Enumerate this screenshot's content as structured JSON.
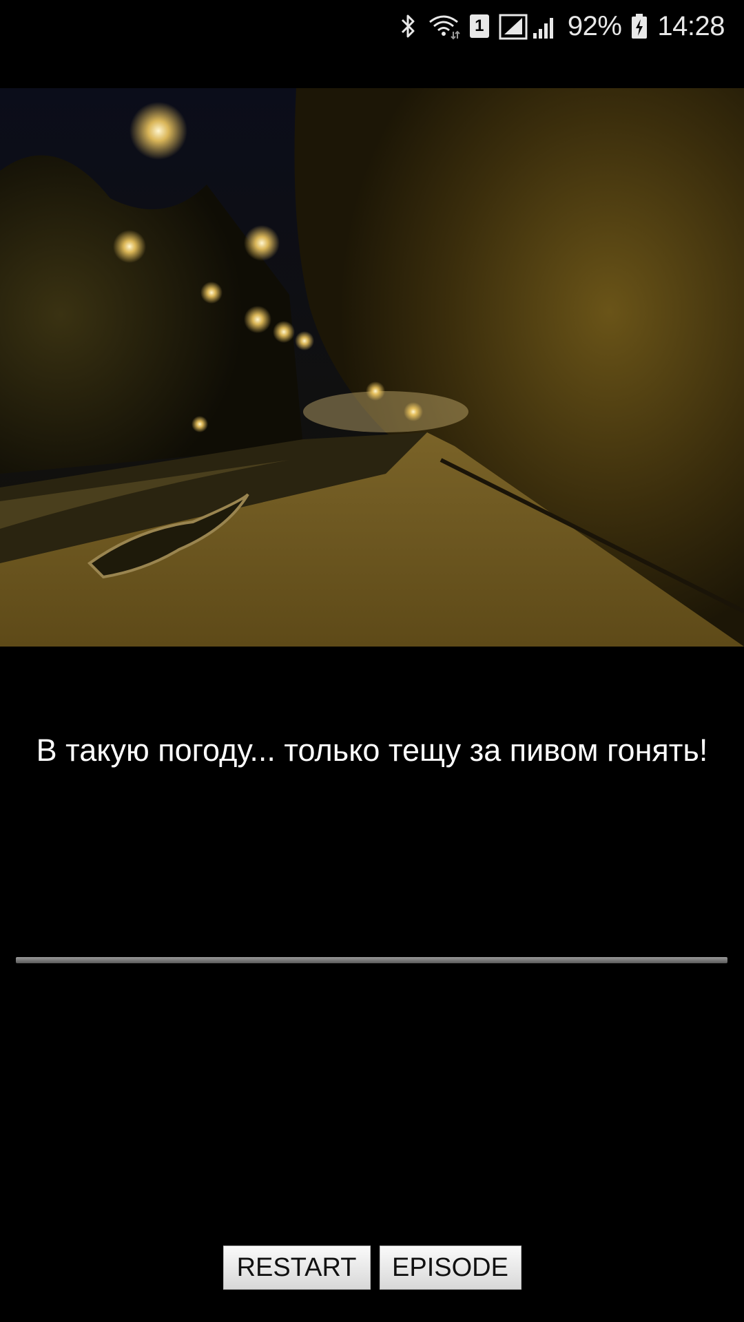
{
  "status_bar": {
    "bluetooth_icon": "bluetooth-icon",
    "wifi_icon": "wifi-icon",
    "sim_label": "1",
    "signal_icon": "signal-icon",
    "battery_percent": "92%",
    "battery_icon": "battery-charging-icon",
    "time": "14:28"
  },
  "scene": {
    "image_icon": "night-street-scene"
  },
  "dialogue": {
    "text": "В такую погоду... только тещу за пивом гонять!"
  },
  "buttons": {
    "restart_label": "RESTART",
    "episode_label": "EPISODE"
  },
  "colors": {
    "background": "#000000",
    "text": "#ffffff",
    "button_bg": "#e6e6e6"
  }
}
